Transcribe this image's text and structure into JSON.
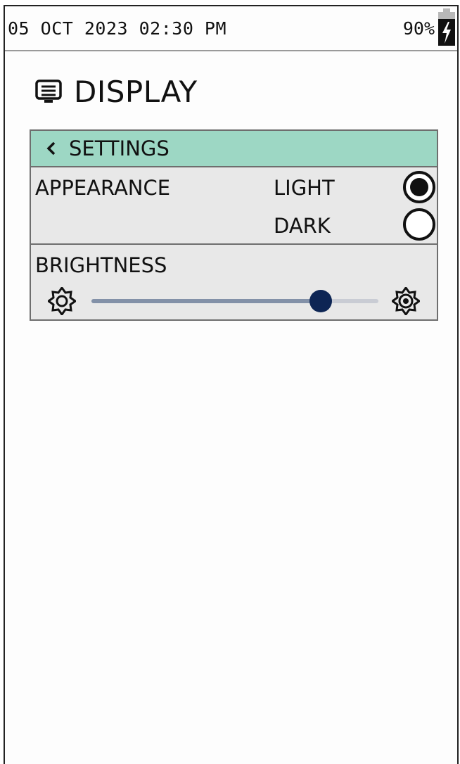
{
  "status_bar": {
    "datetime": "05 OCT 2023 02:30 PM",
    "battery_percent": "90%",
    "battery_icon": "battery-charging-icon"
  },
  "header": {
    "icon": "display-icon",
    "title": "DISPLAY"
  },
  "back": {
    "icon": "chevron-left-icon",
    "label": "SETTINGS",
    "color": "#9dd7c4"
  },
  "appearance": {
    "label": "APPEARANCE",
    "options": [
      {
        "label": "LIGHT",
        "selected": true
      },
      {
        "label": "DARK",
        "selected": false
      }
    ]
  },
  "brightness": {
    "label": "BRIGHTNESS",
    "low_icon": "sun-low-icon",
    "high_icon": "sun-high-icon",
    "level": 0.8,
    "thumb_color": "#0d2554"
  }
}
